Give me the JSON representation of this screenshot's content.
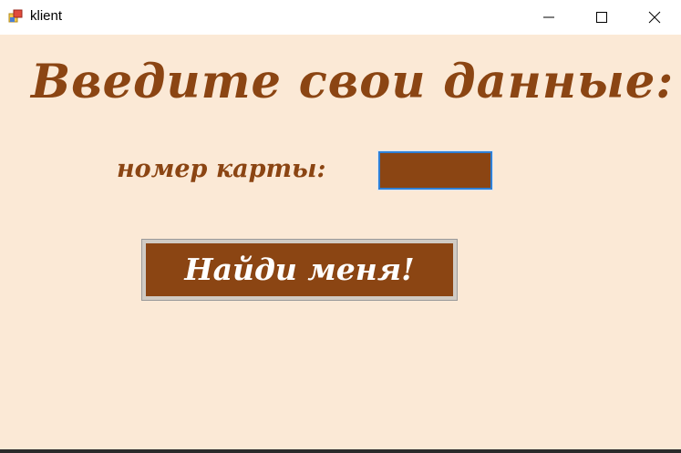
{
  "window": {
    "title": "klient",
    "icon": "app-window-icon",
    "controls": {
      "minimize_icon": "minimize-icon",
      "maximize_icon": "maximize-icon",
      "close_icon": "close-icon"
    }
  },
  "form": {
    "heading": "Введите свои данные:",
    "card_label": "номер карты:",
    "card_value": "",
    "submit_label": "Найди меня!"
  },
  "colors": {
    "background": "#fbe9d6",
    "accent": "#8b4513",
    "input_focus_border": "#2f7fd4"
  }
}
